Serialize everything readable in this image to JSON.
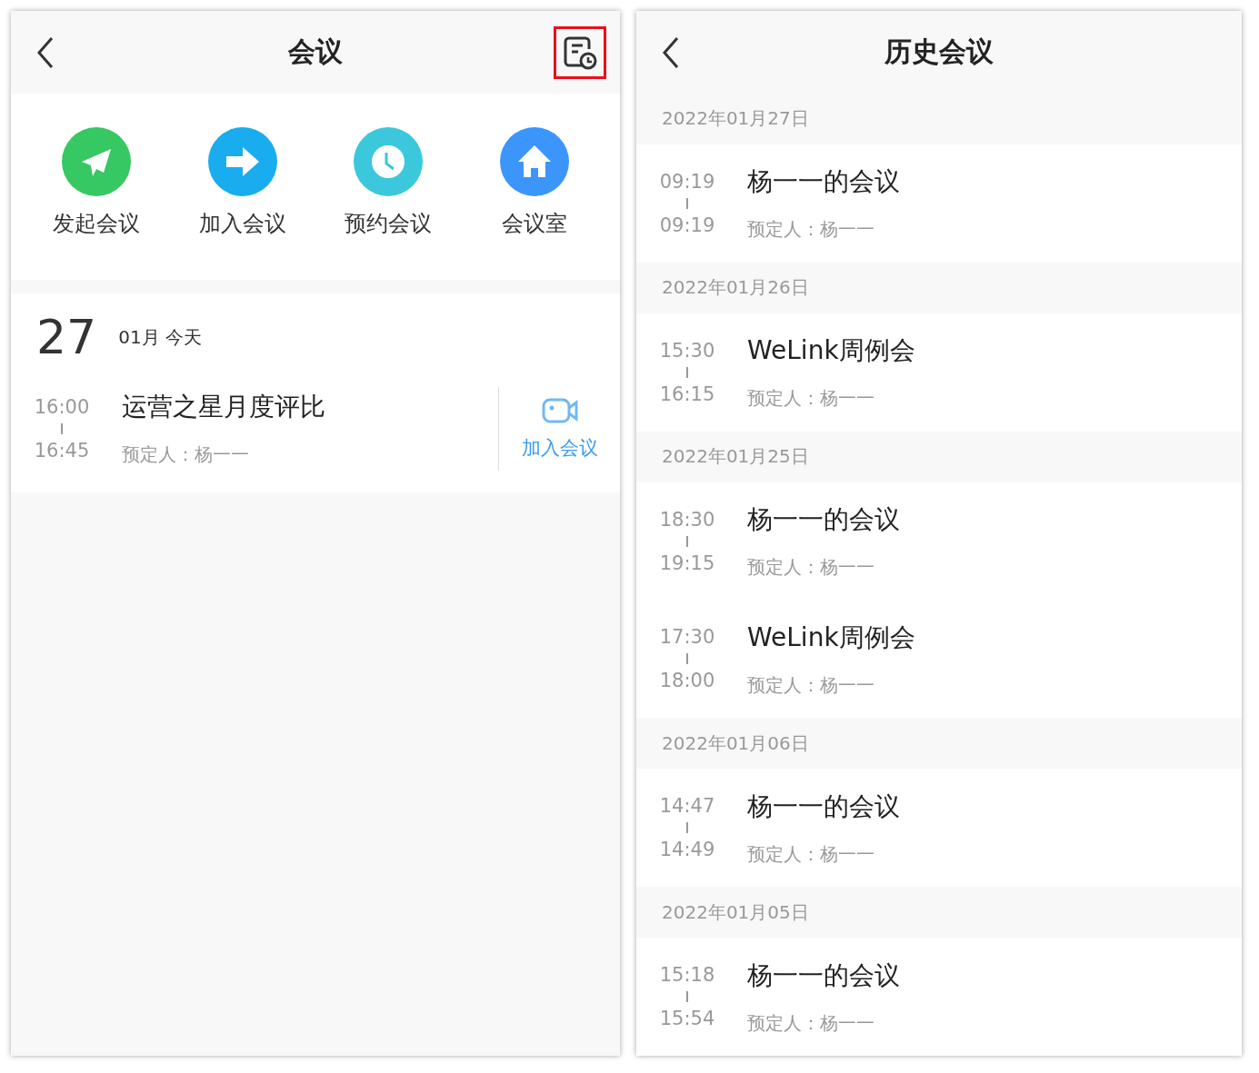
{
  "meeting_screen": {
    "title": "会议",
    "history_button": {
      "highlighted": true
    },
    "actions": [
      {
        "label": "发起会议",
        "kind": "send",
        "color": "#36c862"
      },
      {
        "label": "加入会议",
        "kind": "arrow",
        "color": "#19adef"
      },
      {
        "label": "预约会议",
        "kind": "clock",
        "color": "#3bc8dc"
      },
      {
        "label": "会议室",
        "kind": "home",
        "color": "#3b95fb"
      }
    ],
    "today": {
      "day": "27",
      "month_label": "01月 今天",
      "meetings": [
        {
          "start": "16:00",
          "end": "16:45",
          "title": "运营之星月度评比",
          "organizer": "预定人：杨一一",
          "join_label": "加入会议"
        }
      ]
    }
  },
  "history_screen": {
    "title": "历史会议",
    "groups": [
      {
        "date": "2022年01月27日",
        "meetings": [
          {
            "start": "09:19",
            "end": "09:19",
            "title": "杨一一的会议",
            "organizer": "预定人：杨一一"
          }
        ]
      },
      {
        "date": "2022年01月26日",
        "meetings": [
          {
            "start": "15:30",
            "end": "16:15",
            "title": "WeLink周例会",
            "organizer": "预定人：杨一一"
          }
        ]
      },
      {
        "date": "2022年01月25日",
        "meetings": [
          {
            "start": "18:30",
            "end": "19:15",
            "title": "杨一一的会议",
            "organizer": "预定人：杨一一"
          },
          {
            "start": "17:30",
            "end": "18:00",
            "title": "WeLink周例会",
            "organizer": "预定人：杨一一"
          }
        ]
      },
      {
        "date": "2022年01月06日",
        "meetings": [
          {
            "start": "14:47",
            "end": "14:49",
            "title": "杨一一的会议",
            "organizer": "预定人：杨一一"
          }
        ]
      },
      {
        "date": "2022年01月05日",
        "meetings": [
          {
            "start": "15:18",
            "end": "15:54",
            "title": "杨一一的会议",
            "organizer": "预定人：杨一一"
          }
        ]
      }
    ]
  }
}
